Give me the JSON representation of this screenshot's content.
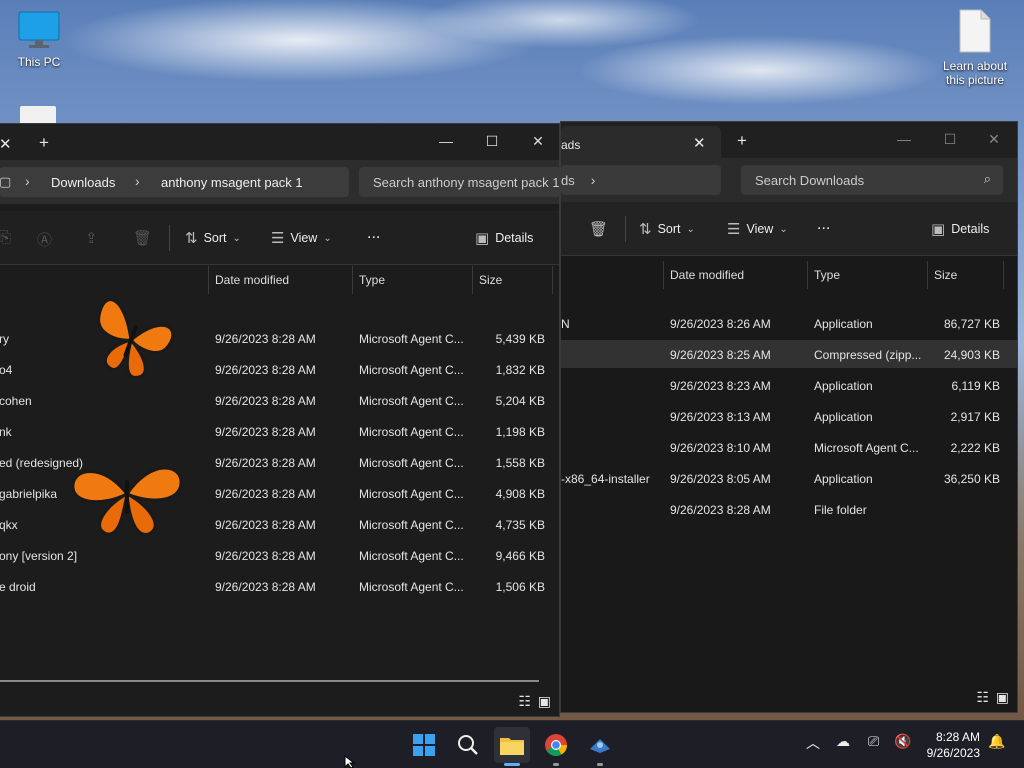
{
  "desktop": {
    "icons": [
      {
        "label": "This PC",
        "icon": "monitor-icon"
      },
      {
        "label": "Learn about this picture",
        "icon": "document-icon"
      }
    ]
  },
  "back_window": {
    "tab_title": "ads",
    "breadcrumb_tail": "ds",
    "search_placeholder": "Search Downloads",
    "toolbar": {
      "sort": "Sort",
      "view": "View",
      "more": "...",
      "details": "Details"
    },
    "columns": {
      "date": "Date modified",
      "type": "Type",
      "size": "Size"
    },
    "rows": [
      {
        "name": "N",
        "date": "9/26/2023 8:26 AM",
        "type": "Application",
        "size": "86,727 KB",
        "selected": false
      },
      {
        "name": "",
        "date": "9/26/2023 8:25 AM",
        "type": "Compressed (zipp...",
        "size": "24,903 KB",
        "selected": true
      },
      {
        "name": "",
        "date": "9/26/2023 8:23 AM",
        "type": "Application",
        "size": "6,119 KB",
        "selected": false
      },
      {
        "name": "",
        "date": "9/26/2023 8:13 AM",
        "type": "Application",
        "size": "2,917 KB",
        "selected": false
      },
      {
        "name": "",
        "date": "9/26/2023 8:10 AM",
        "type": "Microsoft Agent C...",
        "size": "2,222 KB",
        "selected": false
      },
      {
        "name": "-x86_64-installer",
        "date": "9/26/2023 8:05 AM",
        "type": "Application",
        "size": "36,250 KB",
        "selected": false
      },
      {
        "name": "",
        "date": "9/26/2023 8:28 AM",
        "type": "File folder",
        "size": "",
        "selected": false
      }
    ]
  },
  "front_window": {
    "new_tab": "+",
    "breadcrumb": [
      "Downloads",
      "anthony msagent pack 1"
    ],
    "search_placeholder": "Search anthony msagent pack 1",
    "toolbar": {
      "sort": "Sort",
      "view": "View",
      "more": "...",
      "details": "Details"
    },
    "columns": {
      "date": "Date modified",
      "type": "Type",
      "size": "Size"
    },
    "rows": [
      {
        "name": "ry",
        "date": "9/26/2023 8:28 AM",
        "type": "Microsoft Agent C...",
        "size": "5,439 KB"
      },
      {
        "name": "o4",
        "date": "9/26/2023 8:28 AM",
        "type": "Microsoft Agent C...",
        "size": "1,832 KB"
      },
      {
        "name": "cohen",
        "date": "9/26/2023 8:28 AM",
        "type": "Microsoft Agent C...",
        "size": "5,204 KB"
      },
      {
        "name": "nk",
        "date": "9/26/2023 8:28 AM",
        "type": "Microsoft Agent C...",
        "size": "1,198 KB"
      },
      {
        "name": "ed (redesigned)",
        "date": "9/26/2023 8:28 AM",
        "type": "Microsoft Agent C...",
        "size": "1,558 KB"
      },
      {
        "name": "gabrielpika",
        "date": "9/26/2023 8:28 AM",
        "type": "Microsoft Agent C...",
        "size": "4,908 KB"
      },
      {
        "name": "qkx",
        "date": "9/26/2023 8:28 AM",
        "type": "Microsoft Agent C...",
        "size": "4,735 KB"
      },
      {
        "name": "ony [version 2]",
        "date": "9/26/2023 8:28 AM",
        "type": "Microsoft Agent C...",
        "size": "9,466 KB"
      },
      {
        "name": "e droid",
        "date": "9/26/2023 8:28 AM",
        "type": "Microsoft Agent C...",
        "size": "1,506 KB"
      }
    ]
  },
  "taskbar": {
    "apps": [
      "start-icon",
      "search-icon",
      "file-explorer-icon",
      "chrome-icon",
      "agent-app-icon"
    ],
    "time": "8:28 AM",
    "date": "9/26/2023"
  },
  "colors": {
    "accent": "#0078d4",
    "folder": "#f0c040",
    "butterfly": "#f07a10"
  }
}
